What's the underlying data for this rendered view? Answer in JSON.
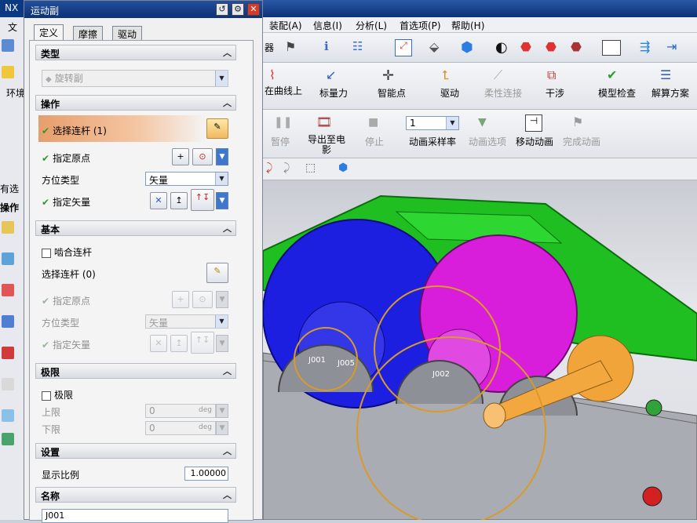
{
  "app": {
    "title": "NX"
  },
  "left_strip": {
    "labels": [
      "文",
      "环境",
      "有选",
      "操作"
    ]
  },
  "dialog": {
    "title": "运动副",
    "tabs": [
      "定义",
      "摩擦",
      "驱动"
    ],
    "type_section": {
      "header": "类型",
      "value": "旋转副"
    },
    "op_section": {
      "header": "操作",
      "select_link": "选择连杆 (1)",
      "origin": "指定原点",
      "orient_label": "方位类型",
      "orient_value": "矢量",
      "vector": "指定矢量"
    },
    "base_section": {
      "header": "基本",
      "mesh": "啮合连杆",
      "select_link": "选择连杆 (0)",
      "origin": "指定原点",
      "orient_label": "方位类型",
      "orient_value": "矢量",
      "vector": "指定矢量"
    },
    "limit_section": {
      "header": "极限",
      "limit": "极限",
      "upper": "上限",
      "lower": "下限",
      "upper_value": "0",
      "lower_value": "0",
      "unit": "deg"
    },
    "settings_section": {
      "header": "设置",
      "scale_label": "显示比例",
      "scale_value": "1.00000"
    },
    "name_section": {
      "header": "名称",
      "name_value": "J001"
    }
  },
  "menubar": {
    "items": [
      "装配(A)",
      "信息(I)",
      "分析(L)",
      "首选项(P)",
      "帮助(H)"
    ],
    "left_fragment": "器"
  },
  "toolbar2": {
    "labels": [
      "在曲线上",
      "标量力",
      "智能点",
      "驱动",
      "柔性连接",
      "干涉",
      "模型检查",
      "解算方案"
    ]
  },
  "toolbar3": {
    "labels": [
      "暂停",
      "导出至电影",
      "停止",
      "动画采样率",
      "动画选项",
      "移动动画",
      "完成动画"
    ],
    "sample_rate": "1"
  },
  "viewport": {
    "joint_labels": [
      "J001",
      "J005",
      "J002"
    ]
  },
  "colors": {
    "accent_title": "#0c3176",
    "housing_green": "#1fbf22",
    "gear_blue": "#1d1fe0",
    "gear_magenta": "#d81ddb",
    "shaft_orange": "#f1a43a",
    "base_gray": "#a9adb3"
  }
}
